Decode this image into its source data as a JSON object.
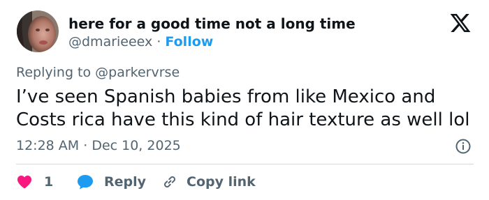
{
  "author": {
    "display_name": "here for a good time not a long time",
    "handle": "@dmarieeex",
    "separator": "·",
    "follow_label": "Follow"
  },
  "reply_to": {
    "text": "Replying to @parkervrse"
  },
  "tweet": {
    "text": "I’ve seen Spanish babies from like Mexico and Costs rica have this kind of hair texture as well lol"
  },
  "meta": {
    "time": "12:28 AM",
    "separator": "·",
    "date": "Dec 10, 2025"
  },
  "actions": {
    "like_count": "1",
    "reply_label": "Reply",
    "copy_link_label": "Copy link"
  },
  "icons": {
    "logo": "x-logo-icon",
    "info": "info-icon",
    "like": "heart-icon",
    "reply": "speech-bubble-icon",
    "copy": "link-icon"
  },
  "colors": {
    "text_primary": "#0f1419",
    "text_secondary": "#536471",
    "accent": "#1d9bf0",
    "like": "#f91880",
    "divider": "#cfd9de"
  }
}
